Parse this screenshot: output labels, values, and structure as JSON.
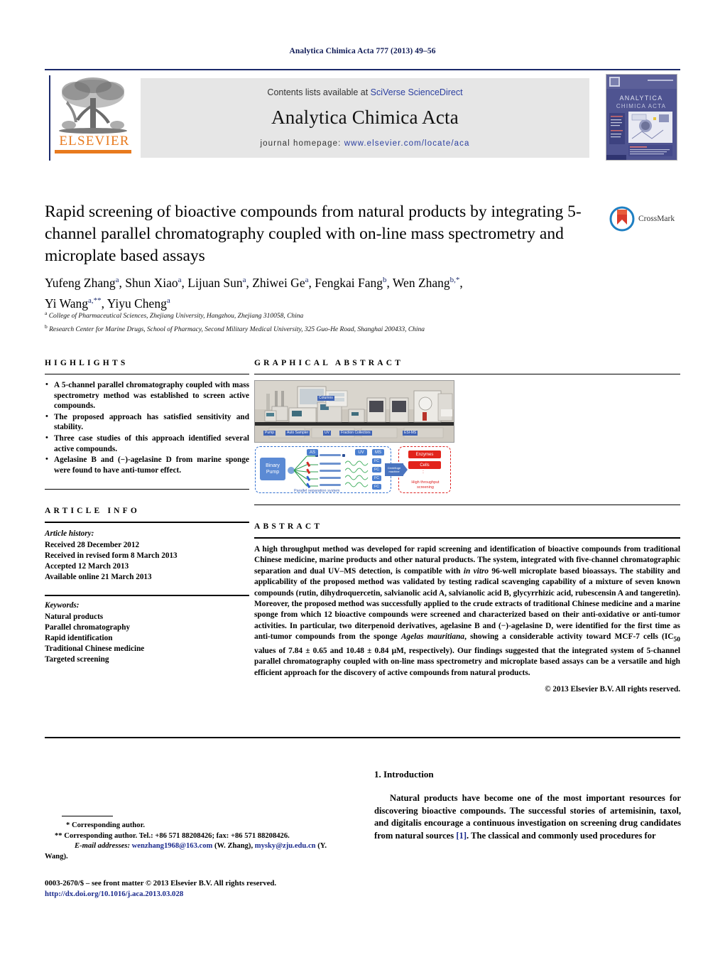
{
  "running_head": "Analytica Chimica Acta 777 (2013) 49–56",
  "masthead": {
    "contents_prefix": "Contents lists available at ",
    "sciencedirect": "SciVerse ScienceDirect",
    "journal_title": "Analytica Chimica Acta",
    "homepage_prefix": "journal homepage: ",
    "homepage_url": "www.elsevier.com/locate/aca",
    "publisher_wordmark": "ELSEVIER",
    "cover_title_line1": "ANALYTICA",
    "cover_title_line2": "CHIMICA ACTA",
    "accent_orange": "#e87a1e",
    "accent_blue": "#2b3fa0",
    "cover_bg": "#4a4f86"
  },
  "article": {
    "title": "Rapid screening of bioactive compounds from natural products by integrating 5-channel parallel chromatography coupled with on-line mass spectrometry and microplate based assays",
    "crossmark_label": "CrossMark",
    "authors": "Yufeng Zhang a , Shun Xiao a , Lijuan Sun a , Zhiwei Ge a , Fengkai Fang b , Wen Zhang b,* , Yi Wang a,** , Yiyu Cheng a",
    "affiliation_a": "a College of Pharmaceutical Sciences, Zhejiang University, Hangzhou, Zhejiang 310058, China",
    "affiliation_b": "b Research Center for Marine Drugs, School of Pharmacy, Second Military Medical University, 325 Guo-He Road, Shanghai 200433, China"
  },
  "highlights": {
    "heading": "HIGHLIGHTS",
    "items": [
      "A 5-channel parallel chromatography coupled with mass spectrometry method was established to screen active compounds.",
      "The proposed approach has satisfied sensitivity and stability.",
      "Three case studies of this approach identified several active compounds.",
      "Agelasine B and (−)-agelasine D from marine sponge were found to have anti-tumor effect."
    ]
  },
  "graphical_abstract": {
    "heading": "GRAPHICAL ABSTRACT",
    "photo_labels": [
      "Pump",
      "Auto Sampler",
      "UV",
      "Fraction Collectors",
      "ESI-MS",
      "Columns"
    ],
    "diagram": {
      "pump_label": "Binary Pump",
      "as_label": "AS",
      "uv_label": "UV",
      "ms_label": "MS",
      "fraction_tags": [
        "FC",
        "FC",
        "FC",
        "FC"
      ],
      "centrifuge_label": "Centrifuge machine",
      "left_caption": "Parallel separation system",
      "enzymes_label": "Enzymes",
      "cells_label": "Cells",
      "dots": ":",
      "right_caption": "High throughput screening"
    }
  },
  "article_info": {
    "heading": "ARTICLE INFO",
    "history_label": "Article history:",
    "history": [
      "Received 28 December 2012",
      "Received in revised form 8 March 2013",
      "Accepted 12 March 2013",
      "Available online 21 March 2013"
    ],
    "keywords_label": "Keywords:",
    "keywords": [
      "Natural products",
      "Parallel chromatography",
      "Rapid identification",
      "Traditional Chinese medicine",
      "Targeted screening"
    ]
  },
  "abstract": {
    "heading": "ABSTRACT",
    "para_1": "A high throughput method was developed for rapid screening and identification of bioactive compounds from traditional Chinese medicine, marine products and other natural products. The system, integrated with five-channel chromatographic separation and dual UV–MS detection, is compatible with ",
    "italic_1": "in vitro",
    "para_2": " 96-well microplate based bioassays. The stability and applicability of the proposed method was validated by testing radical scavenging capability of a mixture of seven known compounds (rutin, dihydroquercetin, salvianolic acid A, salvianolic acid B, glycyrrhizic acid, rubescensin A and tangeretin). Moreover, the proposed method was successfully applied to the crude extracts of traditional Chinese medicine and a marine sponge from which 12 bioactive compounds were screened and characterized based on their anti-oxidative or anti-tumor activities. In particular, two diterpenoid derivatives, agelasine B and (−)-agelasine D, were identified for the first time as anti-tumor compounds from the sponge ",
    "italic_2": "Agelas mauritiana",
    "para_3": ", showing a considerable activity toward MCF-7 cells (IC",
    "sub_1": "50",
    "para_4": " values of 7.84 ± 0.65 and 10.48 ± 0.84 μM, respectively). Our findings suggested that the integrated system of 5-channel parallel chromatography coupled with on-line mass spectrometry and microplate based assays can be a versatile and high efficient approach for the discovery of active compounds from natural products.",
    "copyright": "© 2013 Elsevier B.V. All rights reserved."
  },
  "footnotes": {
    "corresponding_1": "* Corresponding author.",
    "corresponding_2": "** Corresponding author. Tel.: +86 571 88208426; fax: +86 571 88208426.",
    "email_label": "E-mail addresses:",
    "email_1": "wenzhang1968@163.com",
    "email_1_owner": "(W. Zhang),",
    "email_2": "mysky@zju.edu.cn",
    "email_2_owner": "(Y. Wang)."
  },
  "issn": {
    "line": "0003-2670/$ – see front matter © 2013 Elsevier B.V. All rights reserved.",
    "doi": "http://dx.doi.org/10.1016/j.aca.2013.03.028"
  },
  "introduction": {
    "heading": "1.  Introduction",
    "body_1": "Natural products have become one of the most important resources for discovering bioactive compounds. The successful stories of artemisinin, taxol, and digitalis encourage a continuous investigation on screening drug candidates from natural sources ",
    "ref": "[1]",
    "body_2": ". The classical and commonly used procedures for"
  }
}
